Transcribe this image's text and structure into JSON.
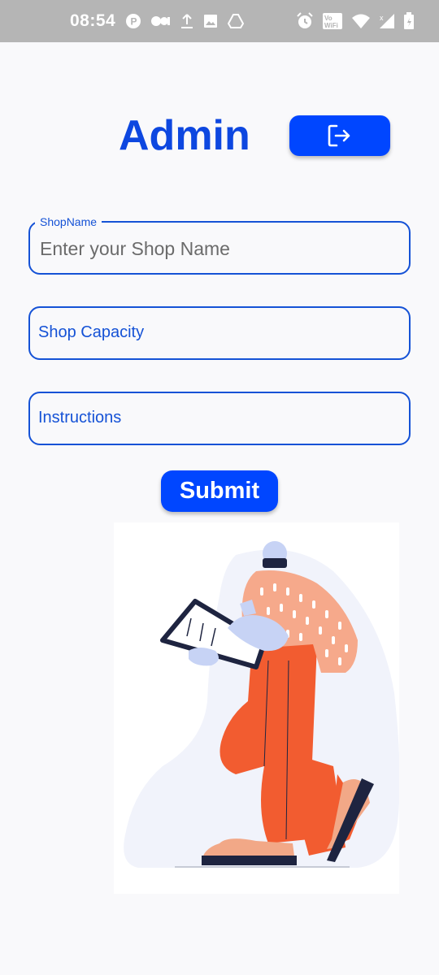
{
  "status_bar": {
    "time": "08:54",
    "icons_left": [
      "p-badge-icon",
      "record-icon",
      "upload-icon",
      "image-icon",
      "drive-icon"
    ],
    "icons_right": [
      "alarm-icon",
      "vowifi-icon",
      "wifi-icon",
      "signal-icon",
      "battery-icon"
    ],
    "vowifi_text": "Vo WiFi"
  },
  "header": {
    "title": "Admin",
    "logout_icon": "logout-icon"
  },
  "form": {
    "shop_name": {
      "label": "ShopName",
      "placeholder": "Enter your Shop Name",
      "value": ""
    },
    "shop_capacity": {
      "label": "Shop Capacity"
    },
    "instructions": {
      "label": "Instructions"
    },
    "submit_label": "Submit"
  },
  "colors": {
    "primary": "#0046ff",
    "title": "#0d47e0",
    "border": "#1552d6",
    "background": "#f9f9fb",
    "status_bar": "#b5b5b5"
  }
}
